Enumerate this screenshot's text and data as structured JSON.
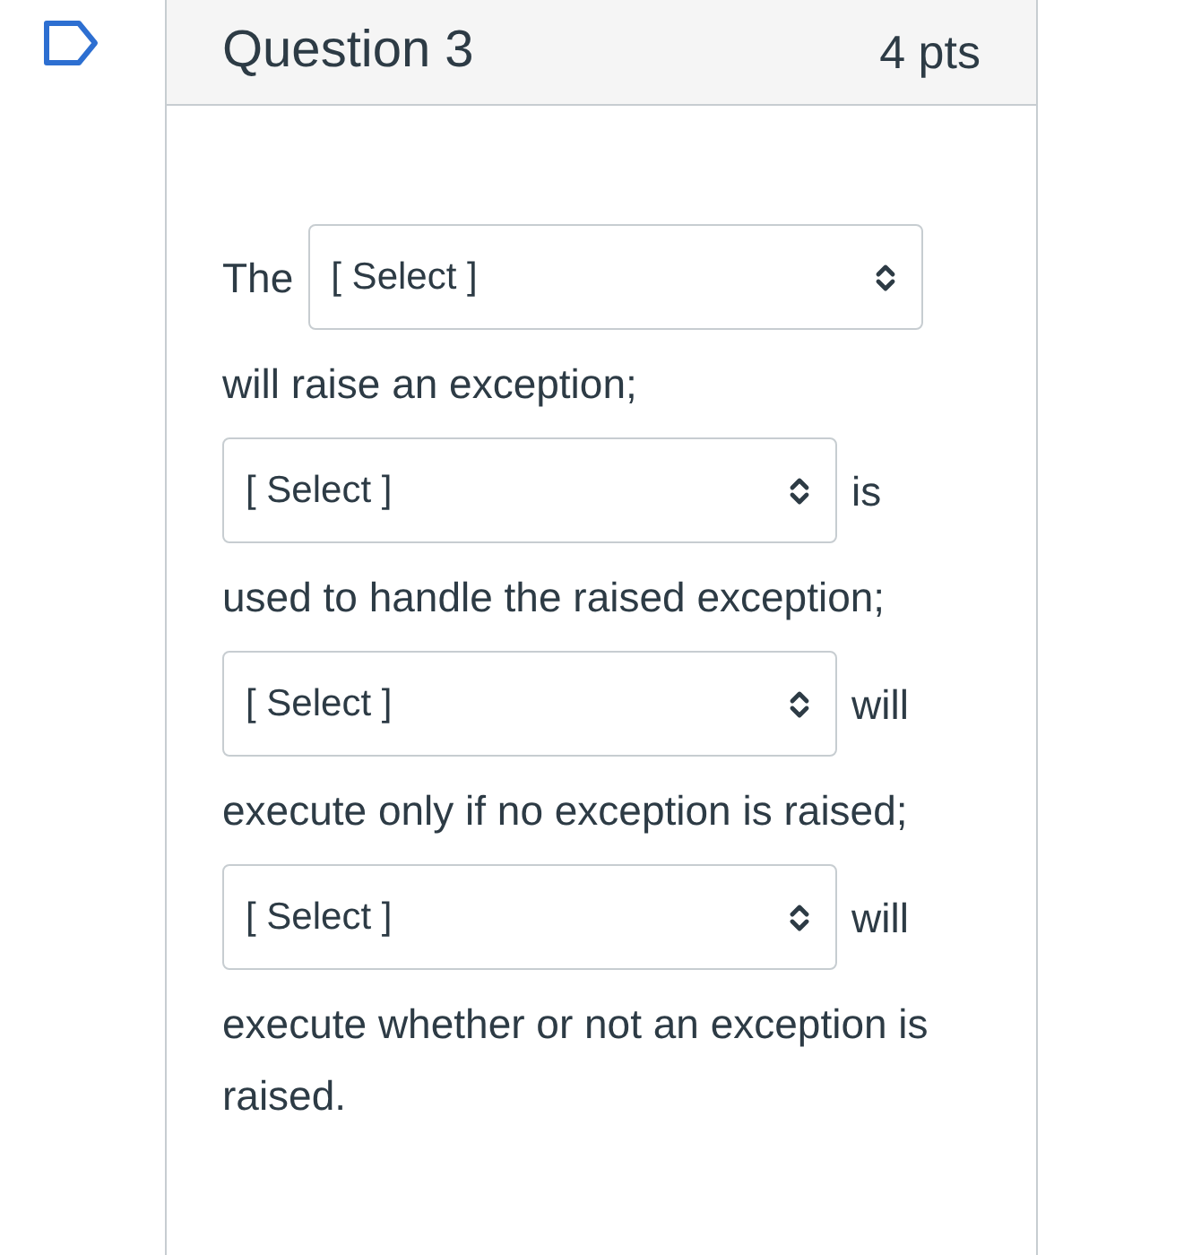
{
  "question": {
    "title": "Question 3",
    "points": "4 pts"
  },
  "content": [
    {
      "kind": "text",
      "text": "The"
    },
    {
      "kind": "select",
      "value": "[ Select ]"
    },
    {
      "kind": "text",
      "text": "will raise an exception;"
    },
    {
      "kind": "select",
      "value": "[ Select ]"
    },
    {
      "kind": "text",
      "text": "is"
    },
    {
      "kind": "text",
      "text": "used to handle the raised exception;"
    },
    {
      "kind": "select",
      "value": "[ Select ]"
    },
    {
      "kind": "text",
      "text": "will"
    },
    {
      "kind": "text",
      "text": "execute only if no exception is raised;"
    },
    {
      "kind": "select",
      "value": "[ Select ]"
    },
    {
      "kind": "text",
      "text": "will"
    },
    {
      "kind": "text",
      "text": "execute whether or not an exception is raised."
    }
  ]
}
